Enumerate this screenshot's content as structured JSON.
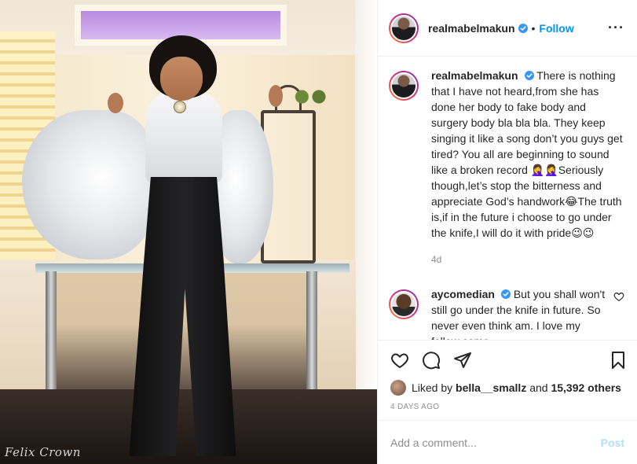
{
  "post": {
    "author": "realmabelmakun",
    "follow_label": "Follow",
    "separator": "•",
    "more_label": "···",
    "photo_signature": "Felix Crown"
  },
  "caption": {
    "username": "realmabelmakun",
    "text": "There is nothing that I have not heard,from she has done her body to fake body and surgery body bla bla bla. They keep singing it like a song don’t you guys get tired? You all are beginning to sound like a broken record 🤦‍♀️🤦‍♀️Seriously though,let’s stop the bitterness and appreciate God’s handwork😂The truth is,if in the future i choose to go under the knife,I will do it with pride😉😉",
    "age": "4d"
  },
  "comments": [
    {
      "username": "aycomedian",
      "text": "But you shall won't still go under the knife in future. So never even think am. I love my follow come"
    }
  ],
  "likes": {
    "prefix": "Liked by",
    "user": "bella__smallz",
    "connector": "and",
    "others": "15,392 others"
  },
  "date": "4 DAYS AGO",
  "add_comment": {
    "placeholder": "Add a comment...",
    "post_label": "Post"
  },
  "colors": {
    "accent": "#0095f6",
    "verified": "#3897f0",
    "muted": "#8e8e8e",
    "post_disabled": "#b2dffc"
  },
  "icons": [
    "verified-icon",
    "heart-icon",
    "comment-icon",
    "share-icon",
    "save-icon",
    "more-icon"
  ]
}
